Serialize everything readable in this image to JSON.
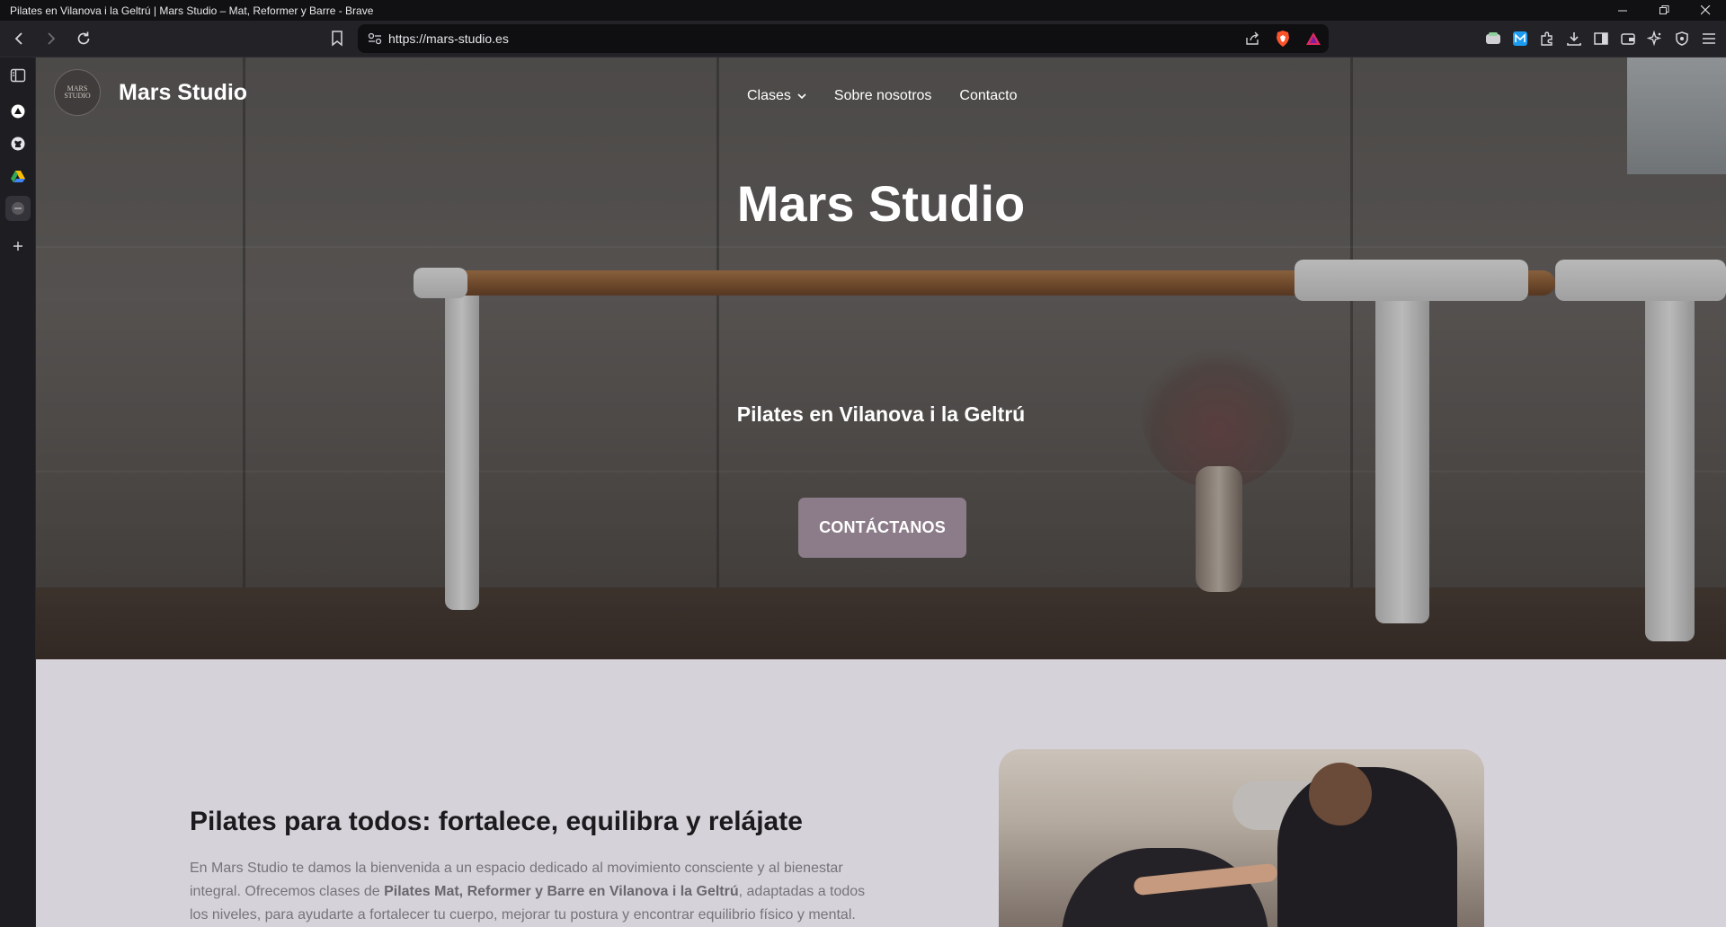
{
  "window": {
    "title": "Pilates en Vilanova i la Geltrú | Mars Studio – Mat, Reformer y Barre - Brave"
  },
  "toolbar": {
    "url": "https://mars-studio.es"
  },
  "site": {
    "logo_line1": "MARS",
    "logo_line2": "STUDIO",
    "brand_name": "Mars Studio",
    "nav": {
      "clases": "Clases",
      "about": "Sobre nosotros",
      "contact": "Contacto"
    }
  },
  "hero": {
    "title": "Mars Studio",
    "subtitle": "Pilates en Vilanova i la Geltrú",
    "cta": "CONTÁCTANOS"
  },
  "intro": {
    "heading": "Pilates para todos: fortalece, equilibra y relájate",
    "p_part1": "En Mars Studio te damos la bienvenida a un espacio dedicado al movimiento consciente y al bienestar integral. Ofrecemos clases de ",
    "p_bold": "Pilates Mat, Reformer y Barre en Vilanova i la Geltrú",
    "p_part2": ", adaptadas a todos los niveles, para ayudarte a fortalecer tu cuerpo, mejorar tu postura y encontrar equilibrio físico y mental."
  },
  "colors": {
    "cta_bg": "#8c7c89",
    "content_bg": "#d6d2da"
  }
}
